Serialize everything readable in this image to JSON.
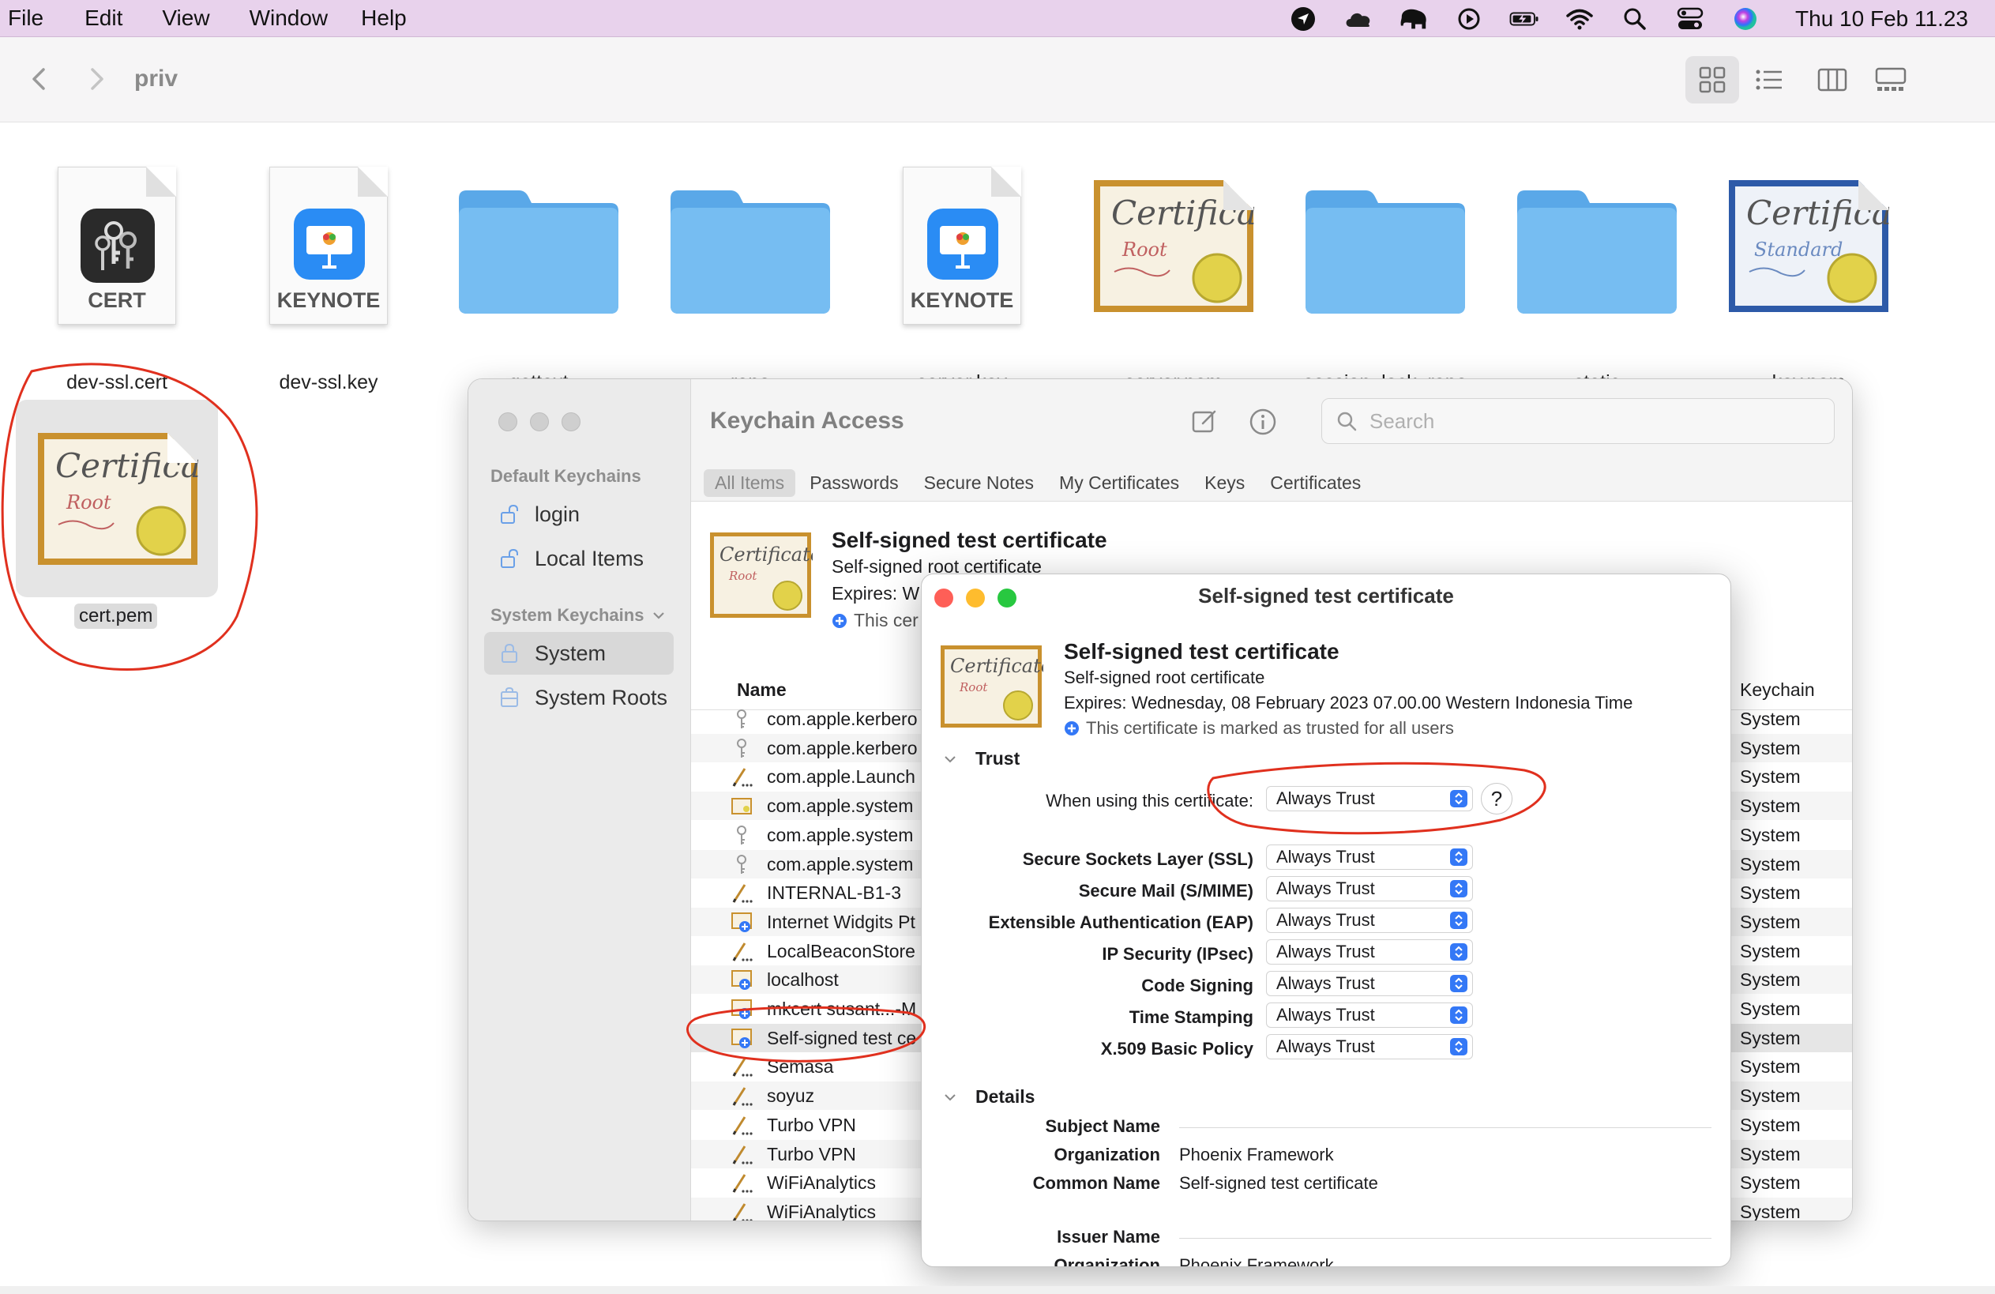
{
  "menubar": {
    "items": [
      "File",
      "Edit",
      "View",
      "Window",
      "Help"
    ],
    "clock": "Thu 10 Feb  11.23",
    "status_icons": [
      "location-arrow-icon",
      "cloud-icon",
      "elephant-icon",
      "play-circle-icon",
      "battery-charging-icon",
      "wifi-icon",
      "search-icon",
      "control-center-icon",
      "siri-icon"
    ]
  },
  "finder": {
    "title": "priv",
    "view_modes": [
      "icon-view-icon",
      "list-view-icon",
      "column-view-icon",
      "gallery-view-icon"
    ],
    "files": [
      {
        "name": "dev-ssl.cert",
        "kind": "doc-cert",
        "label": "CERT"
      },
      {
        "name": "dev-ssl.key",
        "kind": "doc-keynote",
        "label": "KEYNOTE"
      },
      {
        "name": "gettext",
        "kind": "folder"
      },
      {
        "name": "repo",
        "kind": "folder"
      },
      {
        "name": "server.key",
        "kind": "doc-keynote",
        "label": "KEYNOTE"
      },
      {
        "name": "server.pem",
        "kind": "cert-root"
      },
      {
        "name": "session_lock_repo",
        "kind": "folder"
      },
      {
        "name": "static",
        "kind": "folder"
      },
      {
        "name": "key.pem",
        "kind": "cert-standard"
      }
    ],
    "selected_file": {
      "name": "cert.pem",
      "kind": "cert-root"
    }
  },
  "keychain": {
    "title": "Keychain Access",
    "search_placeholder": "Search",
    "sidebar": {
      "default_header": "Default Keychains",
      "default_items": [
        "login",
        "Local Items"
      ],
      "system_header": "System Keychains",
      "system_items": [
        "System",
        "System Roots"
      ]
    },
    "tabs": [
      "All Items",
      "Passwords",
      "Secure Notes",
      "My Certificates",
      "Keys",
      "Certificates"
    ],
    "header": {
      "title": "Self-signed test certificate",
      "subtitle": "Self-signed root certificate",
      "expires": "Expires: W",
      "trust": "This cer"
    },
    "columns": {
      "name": "Name",
      "keychain": "Keychain"
    },
    "rows": [
      {
        "name": "com.apple.kerbero",
        "icon": "key",
        "keychain": "System"
      },
      {
        "name": "com.apple.kerbero",
        "icon": "key",
        "keychain": "System"
      },
      {
        "name": "com.apple.Launch",
        "icon": "pen",
        "keychain": "System"
      },
      {
        "name": "com.apple.system",
        "icon": "cert",
        "keychain": "System"
      },
      {
        "name": "com.apple.system",
        "icon": "key",
        "keychain": "System"
      },
      {
        "name": "com.apple.system",
        "icon": "key",
        "keychain": "System"
      },
      {
        "name": "INTERNAL-B1-3",
        "icon": "pen",
        "keychain": "System"
      },
      {
        "name": "Internet Widgits Pt",
        "icon": "cert-plus",
        "keychain": "System"
      },
      {
        "name": "LocalBeaconStore",
        "icon": "pen",
        "keychain": "System"
      },
      {
        "name": "localhost",
        "icon": "cert-plus",
        "keychain": "System"
      },
      {
        "name": "mkcert susant...-M",
        "icon": "cert-plus",
        "keychain": "System"
      },
      {
        "name": "Self-signed test ce",
        "icon": "cert-plus",
        "keychain": "System",
        "selected": true
      },
      {
        "name": "Semasa",
        "icon": "pen",
        "keychain": "System"
      },
      {
        "name": "soyuz",
        "icon": "pen",
        "keychain": "System"
      },
      {
        "name": "Turbo VPN",
        "icon": "pen",
        "keychain": "System"
      },
      {
        "name": "Turbo VPN",
        "icon": "pen",
        "keychain": "System"
      },
      {
        "name": "WiFiAnalytics",
        "icon": "pen",
        "keychain": "System"
      },
      {
        "name": "WiFiAnalytics",
        "icon": "pen",
        "keychain": "System"
      }
    ]
  },
  "cert_popup": {
    "window_title": "Self-signed test certificate",
    "title": "Self-signed test certificate",
    "subtitle": "Self-signed root certificate",
    "expires": "Expires: Wednesday, 08 February 2023 07.00.00 Western Indonesia Time",
    "trust_status": "This certificate is marked as trusted for all users",
    "trust_section": "Trust",
    "when_using_label": "When using this certificate:",
    "when_using_value": "Always Trust",
    "help_label": "?",
    "policies": [
      {
        "label": "Secure Sockets Layer (SSL)",
        "value": "Always Trust"
      },
      {
        "label": "Secure Mail (S/MIME)",
        "value": "Always Trust"
      },
      {
        "label": "Extensible Authentication (EAP)",
        "value": "Always Trust"
      },
      {
        "label": "IP Security (IPsec)",
        "value": "Always Trust"
      },
      {
        "label": "Code Signing",
        "value": "Always Trust"
      },
      {
        "label": "Time Stamping",
        "value": "Always Trust"
      },
      {
        "label": "X.509 Basic Policy",
        "value": "Always Trust"
      }
    ],
    "details_section": "Details",
    "subject_name": "Subject Name",
    "organization_label": "Organization",
    "organization_value": "Phoenix Framework",
    "common_name_label": "Common Name",
    "common_name_value": "Self-signed test certificate",
    "issuer_name": "Issuer Name",
    "issuer_org_label": "Organization",
    "issuer_org_value": "Phoenix Framework"
  },
  "colors": {
    "menubar_bg": "#e8d2ec",
    "folder_blue": "#6cb4ee",
    "accent_blue": "#3478f6",
    "annotation_red": "#e0301e",
    "traffic_red": "#fe5f57",
    "traffic_yellow": "#febc2e",
    "traffic_green": "#28c840"
  }
}
